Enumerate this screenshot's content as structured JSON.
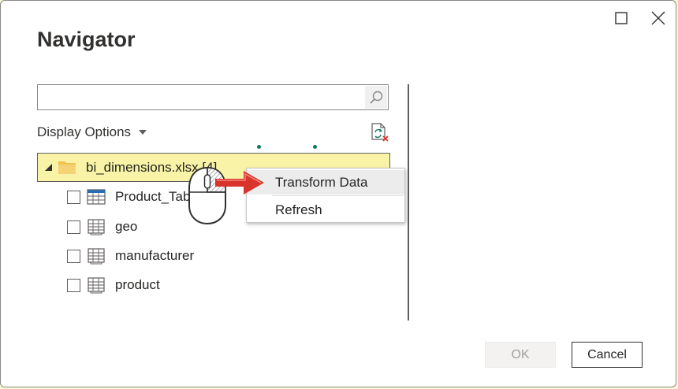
{
  "window": {
    "title": "Navigator",
    "maximize_icon": "maximize-icon",
    "close_icon": "close-icon"
  },
  "search": {
    "value": "",
    "placeholder": "",
    "icon": "search-icon"
  },
  "toolbar": {
    "display_options_label": "Display Options",
    "refresh_icon": "refresh-icon"
  },
  "tree": {
    "root": {
      "label": "bi_dimensions.xlsx [4]",
      "icon": "folder-icon",
      "expanded": true
    },
    "items": [
      {
        "label": "Product_Table",
        "icon": "table-icon",
        "checked": false
      },
      {
        "label": "geo",
        "icon": "sheet-icon",
        "checked": false
      },
      {
        "label": "manufacturer",
        "icon": "sheet-icon",
        "checked": false
      },
      {
        "label": "product",
        "icon": "sheet-icon",
        "checked": false
      }
    ]
  },
  "context_menu": {
    "items": [
      {
        "label": "Transform Data",
        "highlighted": true
      },
      {
        "label": "Refresh",
        "highlighted": false
      }
    ]
  },
  "annotations": {
    "mouse_icon": "right-click-mouse-icon",
    "arrow_icon": "arrow-right-icon",
    "arrow_color": "#d9342b"
  },
  "footer": {
    "ok_label": "OK",
    "cancel_label": "Cancel"
  },
  "colors": {
    "selection_fill": "#f8f3a6",
    "folder": "#f2c14e",
    "accent_dots": "#117865"
  }
}
